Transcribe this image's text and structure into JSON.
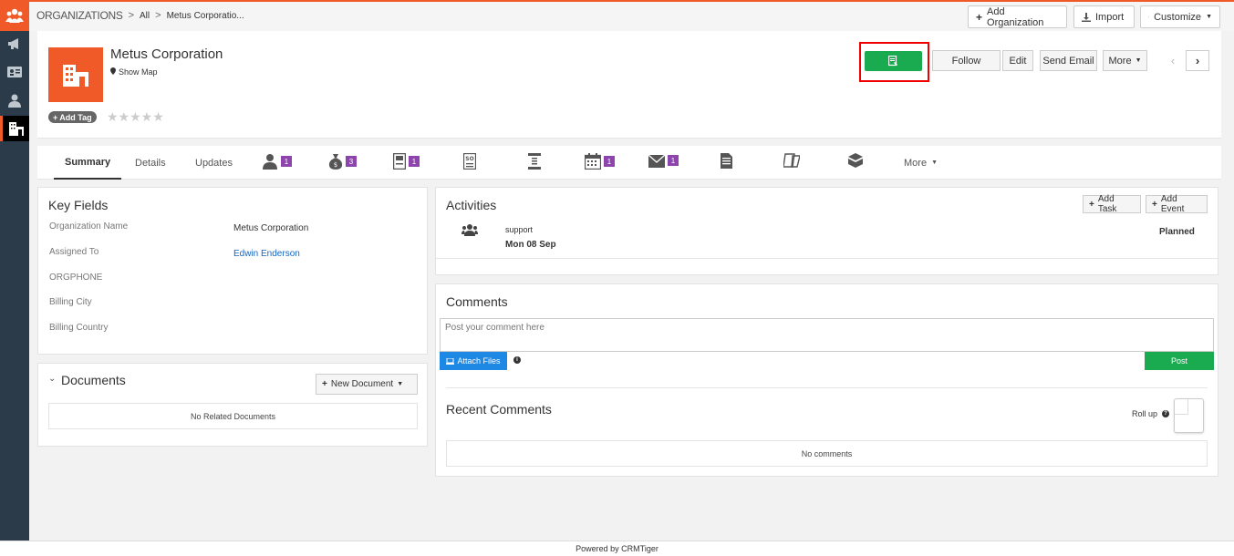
{
  "breadcrumb": {
    "module": "ORGANIZATIONS",
    "separator": ">",
    "all": "All",
    "current": "Metus Corporatio..."
  },
  "top_actions": {
    "add_organization": "Add Organization",
    "import": "Import",
    "customize": "Customize"
  },
  "record": {
    "name": "Metus Corporation",
    "show_map": "Show Map",
    "add_tag": "Add Tag",
    "stars": "★★★★★",
    "star_rating": 0
  },
  "record_actions": {
    "follow": "Follow",
    "edit": "Edit",
    "send_email": "Send Email",
    "more": "More"
  },
  "tabs": {
    "summary": "Summary",
    "details": "Details",
    "updates": "Updates",
    "more": "More",
    "icon_tabs": [
      {
        "icon": "contacts-icon",
        "count": "1"
      },
      {
        "icon": "money-bag-icon",
        "count": "3"
      },
      {
        "icon": "quotes-icon",
        "count": "1"
      },
      {
        "icon": "sales-order-icon",
        "count": ""
      },
      {
        "icon": "invoice-icon",
        "count": ""
      },
      {
        "icon": "calendar-icon",
        "count": "1"
      },
      {
        "icon": "envelope-icon",
        "count": "1"
      },
      {
        "icon": "document-icon",
        "count": ""
      },
      {
        "icon": "tickets-icon",
        "count": ""
      },
      {
        "icon": "products-icon",
        "count": ""
      }
    ]
  },
  "key_fields": {
    "title": "Key Fields",
    "rows": [
      {
        "label": "Organization Name",
        "value": "Metus Corporation"
      },
      {
        "label": "Assigned To",
        "value": "Edwin Enderson"
      },
      {
        "label": "ORGPHONE",
        "value": ""
      },
      {
        "label": "Billing City",
        "value": ""
      },
      {
        "label": "Billing Country",
        "value": ""
      }
    ]
  },
  "documents": {
    "title": "Documents",
    "new_document": "New Document",
    "empty": "No Related Documents"
  },
  "activities": {
    "title": "Activities",
    "add_task": "Add Task",
    "add_event": "Add Event",
    "items": [
      {
        "subject": "support",
        "date": "Mon 08 Sep",
        "status": "Planned"
      }
    ]
  },
  "comments": {
    "title": "Comments",
    "placeholder": "Post your comment here",
    "attach_files": "Attach Files",
    "post": "Post",
    "recent_title": "Recent Comments",
    "roll_up": "Roll up",
    "empty": "No comments"
  },
  "footer": {
    "text": "Powered by CRMTiger"
  },
  "colors": {
    "brand": "#f05a28",
    "rail": "#2c3b49",
    "green": "#1aab51",
    "badge": "#8e44ad",
    "attach_blue": "#1e88e5",
    "highlight": "#ee0000"
  }
}
